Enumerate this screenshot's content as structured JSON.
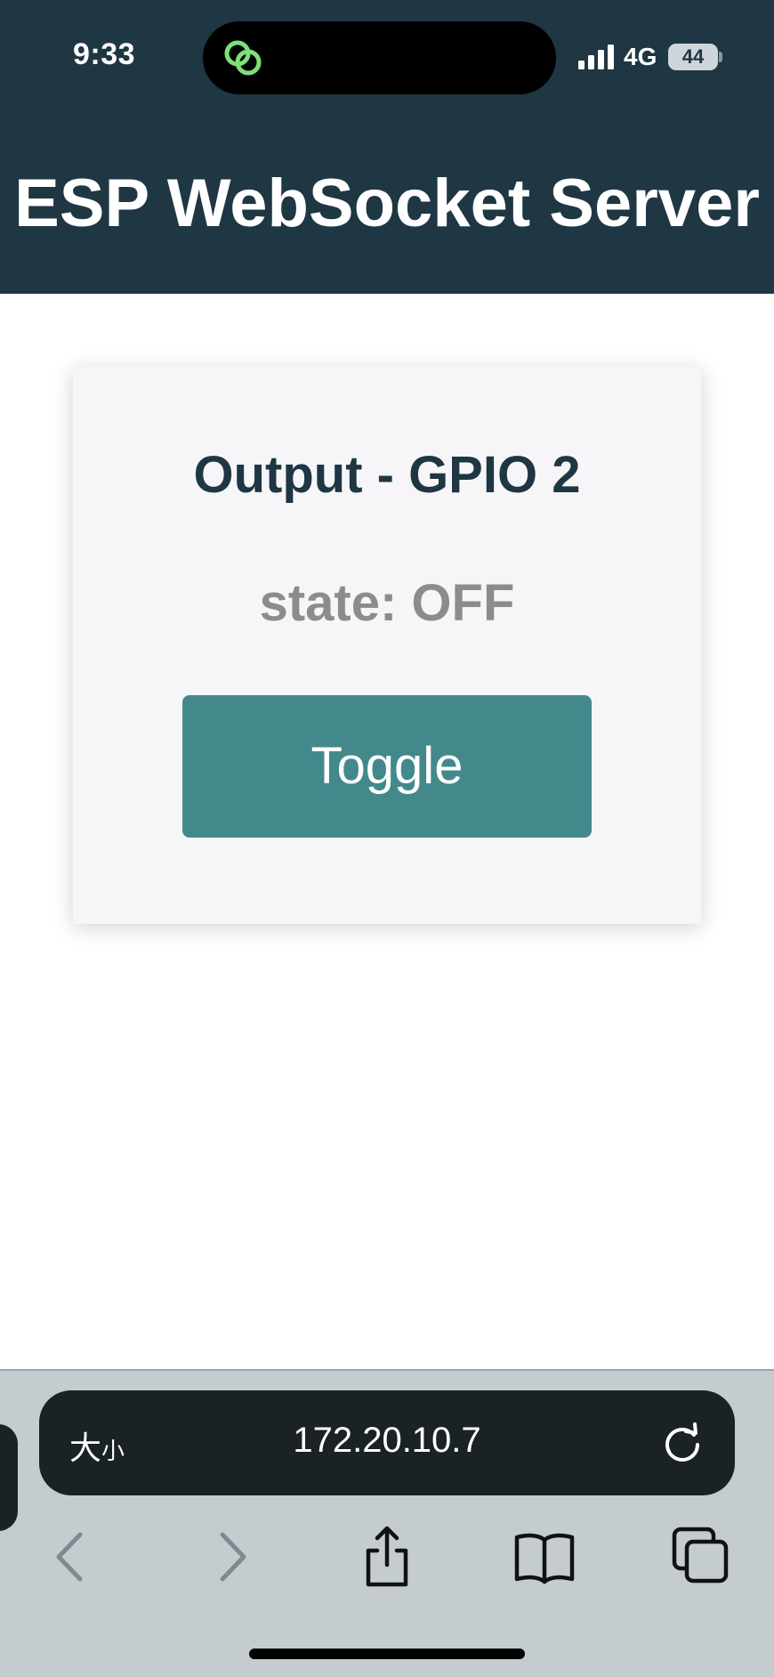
{
  "status_bar": {
    "time": "9:33",
    "network": "4G",
    "battery": "44"
  },
  "header": {
    "title": "ESP WebSocket Server"
  },
  "card": {
    "title": "Output - GPIO 2",
    "state_text": "state: OFF",
    "button_label": "Toggle"
  },
  "browser": {
    "text_size_large": "大",
    "text_size_small": "小",
    "url": "172.20.10.7",
    "toolbar_icons": [
      "back-icon",
      "forward-icon",
      "share-icon",
      "bookmarks-icon",
      "tabs-icon"
    ]
  },
  "colors": {
    "header_bg": "#1f3643",
    "card_title": "#1f3643",
    "state_text": "#8c8c8c",
    "button_bg": "#43898c",
    "card_bg": "#f6f6f9",
    "browser_bar_bg": "#c4ccd0",
    "address_bar_bg": "#1a2226",
    "island_icon_green": "#7ee07a"
  }
}
